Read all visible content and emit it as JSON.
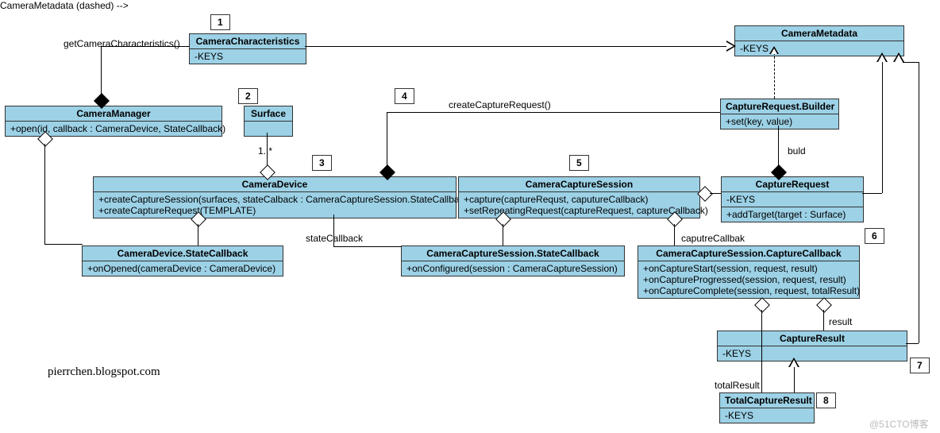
{
  "chart_data": {
    "type": "uml-class-diagram",
    "classes": [
      {
        "id": "CameraManager",
        "attributes": [],
        "operations": [
          "+open(id, callback : CameraDevice, StateCallback)"
        ]
      },
      {
        "id": "CameraCharacteristics",
        "attributes": [
          "-KEYS"
        ],
        "operations": []
      },
      {
        "id": "Surface",
        "attributes": [],
        "operations": []
      },
      {
        "id": "CameraDevice",
        "attributes": [],
        "operations": [
          "+createCaptureSession(surfaces, stateCalback : CameraCaptureSession.StateCallback)",
          "+createCaptureRequest(TEMPLATE)"
        ]
      },
      {
        "id": "CameraDevice.StateCallback",
        "attributes": [],
        "operations": [
          "+onOpened(cameraDevice : CameraDevice)"
        ]
      },
      {
        "id": "CameraCaptureSession",
        "attributes": [],
        "operations": [
          "+capture(captureRequst, caputureCallback)",
          "+setRepeatingRequest(captureRequest, captureCallback)"
        ]
      },
      {
        "id": "CameraCaptureSession.StateCallback",
        "attributes": [],
        "operations": [
          "+onConfigured(session : CameraCaptureSession)"
        ]
      },
      {
        "id": "CameraCaptureSession.CaptureCallback",
        "attributes": [],
        "operations": [
          "+onCaptureStart(session, request, result)",
          "+onCaptureProgressed(session, request, result)",
          "+onCaptureComplete(session, request, totalResult)"
        ]
      },
      {
        "id": "CameraMetadata",
        "attributes": [
          "-KEYS"
        ],
        "operations": []
      },
      {
        "id": "CaptureRequest.Builder",
        "attributes": [],
        "operations": [
          "+set(key, value)"
        ]
      },
      {
        "id": "CaptureRequest",
        "attributes": [
          "-KEYS"
        ],
        "operations": [
          "+addTarget(target : Surface)"
        ]
      },
      {
        "id": "CaptureResult",
        "attributes": [
          "-KEYS"
        ],
        "operations": []
      },
      {
        "id": "TotalCaptureResult",
        "attributes": [
          "-KEYS"
        ],
        "operations": []
      }
    ],
    "relationships": [
      {
        "from": "CameraManager",
        "to": "CameraCharacteristics",
        "type": "composition",
        "label": "getCameraCharacteristics()"
      },
      {
        "from": "CameraCharacteristics",
        "to": "CameraMetadata",
        "type": "generalization"
      },
      {
        "from": "CameraManager",
        "to": "CameraDevice",
        "type": "aggregation"
      },
      {
        "from": "CameraDevice",
        "to": "Surface",
        "type": "aggregation",
        "multiplicity": "1..*"
      },
      {
        "from": "CameraDevice",
        "to": "CameraDevice.StateCallback",
        "type": "aggregation"
      },
      {
        "from": "CameraDevice",
        "to": "CaptureRequest.Builder",
        "type": "composition",
        "label": "createCaptureRequest()"
      },
      {
        "from": "CameraDevice",
        "to": "CameraCaptureSession",
        "type": "dependency",
        "label": "stateCallback"
      },
      {
        "from": "CameraCaptureSession",
        "to": "CameraCaptureSession.StateCallback",
        "type": "aggregation"
      },
      {
        "from": "CameraCaptureSession",
        "to": "CameraCaptureSession.CaptureCallback",
        "type": "aggregation",
        "label": "caputreCallbak"
      },
      {
        "from": "CameraCaptureSession",
        "to": "CaptureRequest",
        "type": "aggregation"
      },
      {
        "from": "CaptureRequest.Builder",
        "to": "CaptureRequest",
        "type": "composition",
        "label": "buld"
      },
      {
        "from": "CaptureRequest",
        "to": "CameraMetadata",
        "type": "generalization"
      },
      {
        "from": "CaptureRequest.Builder",
        "to": "CameraMetadata",
        "type": "dependency"
      },
      {
        "from": "CameraCaptureSession.CaptureCallback",
        "to": "CaptureResult",
        "type": "aggregation",
        "label": "result"
      },
      {
        "from": "CameraCaptureSession.CaptureCallback",
        "to": "TotalCaptureResult",
        "type": "aggregation",
        "label": "totalResult"
      },
      {
        "from": "CaptureResult",
        "to": "CameraMetadata",
        "type": "generalization"
      },
      {
        "from": "TotalCaptureResult",
        "to": "CaptureResult",
        "type": "generalization"
      }
    ]
  },
  "notes": {
    "n1": "1",
    "n2": "2",
    "n3": "3",
    "n4": "4",
    "n5": "5",
    "n6": "6",
    "n7": "7",
    "n8": "8"
  },
  "classes": {
    "CameraManager": {
      "title": "CameraManager",
      "op1": "+open(id, callback : CameraDevice, StateCallback)"
    },
    "CameraCharacteristics": {
      "title": "CameraCharacteristics",
      "attr": "-KEYS"
    },
    "Surface": {
      "title": "Surface"
    },
    "CameraDevice": {
      "title": "CameraDevice",
      "op1": "+createCaptureSession(surfaces, stateCalback : CameraCaptureSession.StateCallback)",
      "op2": "+createCaptureRequest(TEMPLATE)"
    },
    "CameraDeviceStateCallback": {
      "title": "CameraDevice.StateCallback",
      "op1": "+onOpened(cameraDevice : CameraDevice)"
    },
    "CameraCaptureSession": {
      "title": "CameraCaptureSession",
      "op1": "+capture(captureRequst, caputureCallback)",
      "op2": "+setRepeatingRequest(captureRequest, captureCallback)"
    },
    "CCSStateCallback": {
      "title": "CameraCaptureSession.StateCallback",
      "op1": "+onConfigured(session : CameraCaptureSession)"
    },
    "CCSCaptureCallback": {
      "title": "CameraCaptureSession.CaptureCallback",
      "op1": "+onCaptureStart(session, request, result)",
      "op2": "+onCaptureProgressed(session, request, result)",
      "op3": "+onCaptureComplete(session, request, totalResult)"
    },
    "CameraMetadata": {
      "title": "CameraMetadata",
      "attr": "-KEYS"
    },
    "CaptureRequestBuilder": {
      "title": "CaptureRequest.Builder",
      "op1": "+set(key, value)"
    },
    "CaptureRequest": {
      "title": "CaptureRequest",
      "attr": "-KEYS",
      "op1": "+addTarget(target : Surface)"
    },
    "CaptureResult": {
      "title": "CaptureResult",
      "attr": "-KEYS"
    },
    "TotalCaptureResult": {
      "title": "TotalCaptureResult",
      "attr": "-KEYS"
    }
  },
  "labels": {
    "getCamChar": "getCameraCharacteristics()",
    "createCapReq": "createCaptureRequest()",
    "mult": "1..*",
    "stateCallback": "stateCallback",
    "buld": "buld",
    "captureCallback": "caputreCallbak",
    "result": "result",
    "totalResult": "totalResult"
  },
  "credit": "pierrchen.blogspot.com",
  "watermark": "@51CTO博客"
}
